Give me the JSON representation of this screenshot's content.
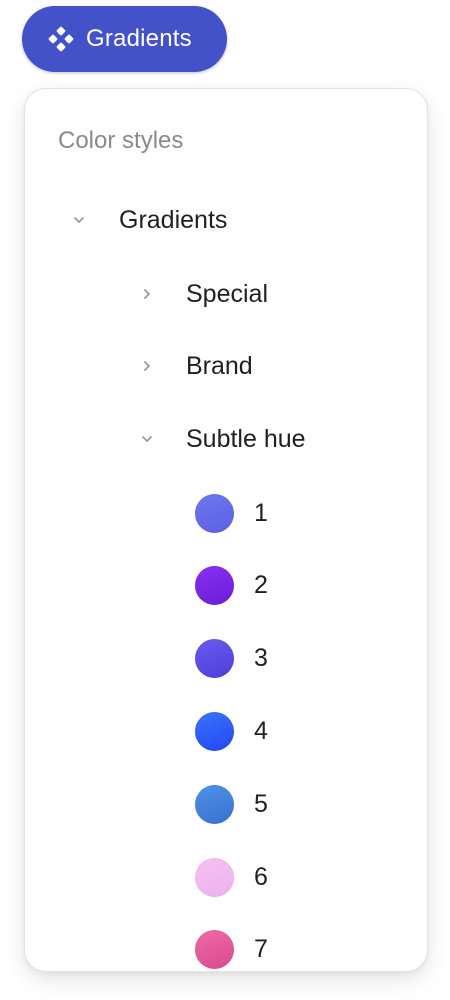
{
  "header_button": {
    "label": "Gradients",
    "icon": "component-icon",
    "color": "#4452c9"
  },
  "panel": {
    "title": "Color styles",
    "groups": [
      {
        "label": "Gradients",
        "expanded": true
      },
      {
        "label": "Special",
        "expanded": false
      },
      {
        "label": "Brand",
        "expanded": false
      },
      {
        "label": "Subtle hue",
        "expanded": true
      }
    ],
    "styles": [
      {
        "label": "1",
        "from": "#7078f0",
        "to": "#5a5fe0"
      },
      {
        "label": "2",
        "from": "#8a2ff0",
        "to": "#6a1ed8"
      },
      {
        "label": "3",
        "from": "#6a5af0",
        "to": "#4c3fd8"
      },
      {
        "label": "4",
        "from": "#3b74ff",
        "to": "#2346f0"
      },
      {
        "label": "5",
        "from": "#4d94e6",
        "to": "#3a6fd0"
      },
      {
        "label": "6",
        "from": "#f5c2f3",
        "to": "#eeb0ee"
      },
      {
        "label": "7",
        "from": "#ee6aa8",
        "to": "#d94a8c"
      }
    ]
  }
}
